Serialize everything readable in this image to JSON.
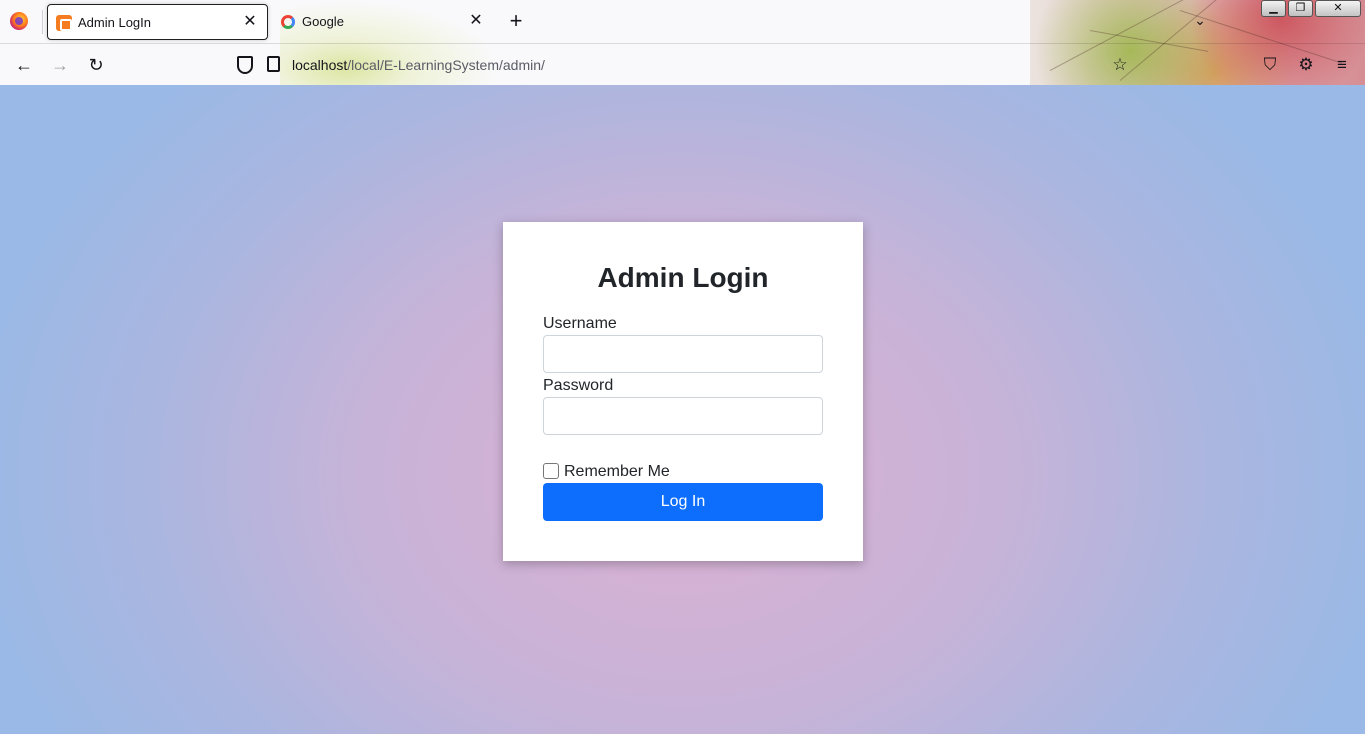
{
  "browser": {
    "tabs": [
      {
        "title": "Admin LogIn",
        "favicon": "xampp-icon",
        "active": true
      },
      {
        "title": "Google",
        "favicon": "google-icon",
        "active": false
      }
    ],
    "tab_close_glyph": "✕",
    "new_tab_glyph": "+",
    "list_tabs_glyph": "⌄",
    "window_controls": {
      "minimize": "▁",
      "maximize": "❐",
      "close": "✕"
    },
    "nav": {
      "back": "←",
      "forward": "→",
      "reload": "↻"
    },
    "url": {
      "host": "localhost",
      "path": "/local/E-LearningSystem/admin/"
    },
    "toolbar": {
      "bookmark": "☆",
      "pocket": "⛉",
      "extensions": "⚙",
      "menu": "≡"
    }
  },
  "login": {
    "title": "Admin Login",
    "username_label": "Username",
    "username_value": "",
    "password_label": "Password",
    "password_value": "",
    "remember_label": "Remember Me",
    "remember_checked": false,
    "submit_label": "Log In"
  },
  "colors": {
    "primary_button": "#0d6efd",
    "background_center": "#dbb0d2",
    "background_edge": "#9ab9e6"
  }
}
